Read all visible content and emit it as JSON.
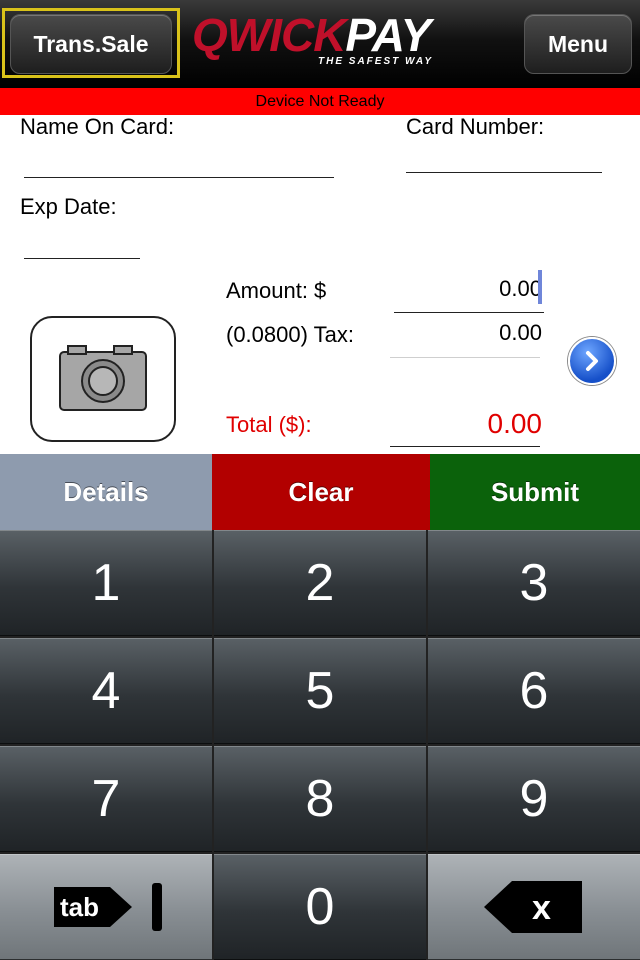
{
  "header": {
    "left_button": "Trans.Sale",
    "right_button": "Menu",
    "logo_left": "QWICK",
    "logo_right": "PAY",
    "tagline": "THE SAFEST WAY"
  },
  "status": "Device Not Ready",
  "form": {
    "name_label": "Name On Card:",
    "card_label": "Card Number:",
    "exp_label": "Exp Date:",
    "amount_label": "Amount: $",
    "amount_value": "0.00",
    "tax_label": "(0.0800) Tax:",
    "tax_value": "0.00",
    "total_label": "Total ($):",
    "total_value": "0.00"
  },
  "actions": {
    "details": "Details",
    "clear": "Clear",
    "submit": "Submit"
  },
  "keypad": {
    "k1": "1",
    "k2": "2",
    "k3": "3",
    "k4": "4",
    "k5": "5",
    "k6": "6",
    "k7": "7",
    "k8": "8",
    "k9": "9",
    "tab": "tab",
    "k0": "0",
    "delete": "x"
  },
  "colors": {
    "status_bar": "#ff0000",
    "total_text": "#e00000",
    "details_bg": "#8e9bae",
    "clear_bg": "#b20000",
    "submit_bg": "#0b620b",
    "focus_outline": "#d9c21a"
  },
  "icons": {
    "camera": "camera-icon",
    "next": "chevron-right-icon",
    "backspace": "backspace-icon"
  }
}
